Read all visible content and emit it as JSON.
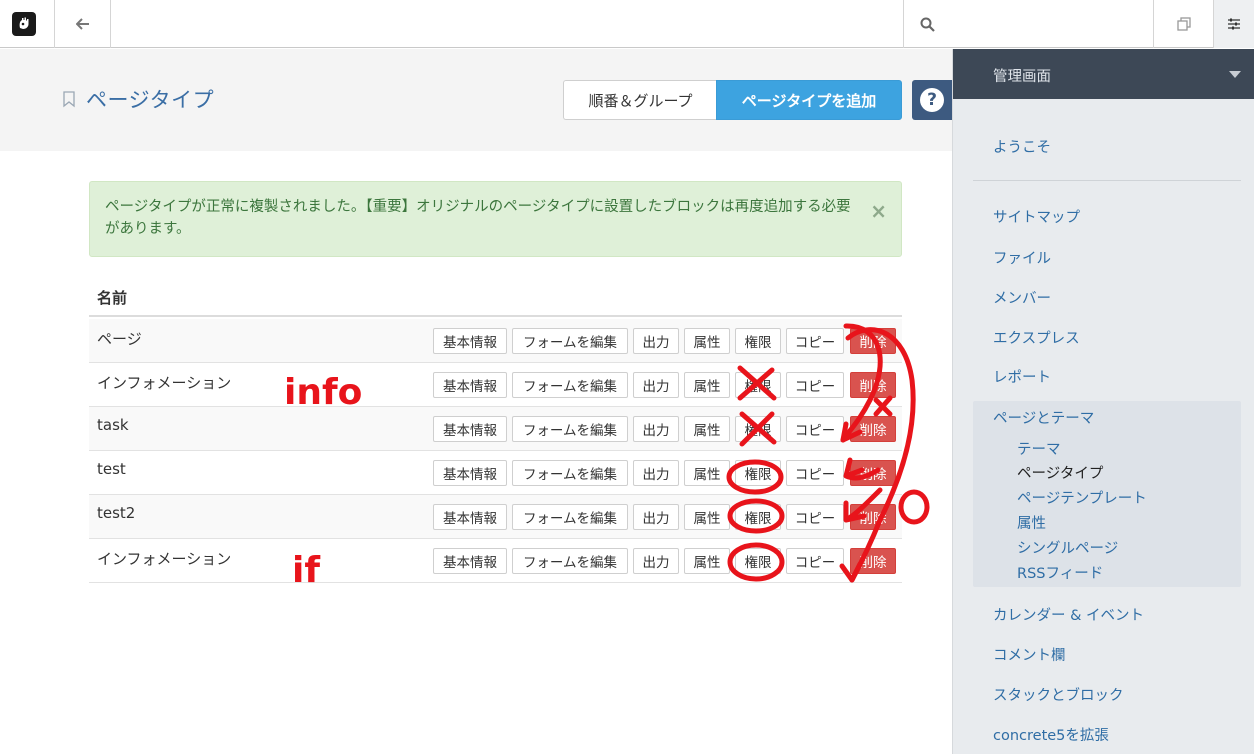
{
  "toolbar": {
    "logo_icon": "concrete5-logo-icon",
    "back_icon": "arrow-left-icon",
    "search_icon": "search-icon",
    "search_placeholder": "",
    "stack_icon": "stack-icon",
    "settings_icon": "sliders-icon"
  },
  "header": {
    "title": "ページタイプ",
    "order_button": "順番＆グループ",
    "add_button": "ページタイプを追加",
    "help_button": "?"
  },
  "alert": {
    "message": "ページタイプが正常に複製されました。【重要】オリジナルのページタイプに設置したブロックは再度追加する必要があります。",
    "close": "×"
  },
  "table": {
    "column_name": "名前",
    "actions": [
      "基本情報",
      "フォームを編集",
      "出力",
      "属性",
      "権限",
      "コピー",
      "削除"
    ],
    "rows": [
      {
        "name": "ページ"
      },
      {
        "name": "インフォメーション"
      },
      {
        "name": "task"
      },
      {
        "name": "test"
      },
      {
        "name": "test2"
      },
      {
        "name": "インフォメーション"
      }
    ]
  },
  "annotations": {
    "row2_note": "info",
    "row6_note": "if",
    "right_x": "x",
    "right_o": "o",
    "color": "#e8141b"
  },
  "sidebar": {
    "header": "管理画面",
    "welcome": "ようこそ",
    "items_top": [
      "サイトマップ",
      "ファイル",
      "メンバー",
      "エクスプレス",
      "レポート"
    ],
    "group_title": "ページとテーマ",
    "group_items": [
      "テーマ",
      "ページタイプ",
      "ページテンプレート",
      "属性",
      "シングルページ",
      "RSSフィード"
    ],
    "items_bottom": [
      "カレンダー & イベント",
      "コメント欄",
      "スタックとブロック",
      "concrete5を拡張"
    ]
  },
  "colors": {
    "accent": "#3da3e0",
    "danger": "#d9534f",
    "link": "#2f6da5",
    "sidebar_header": "#3d4856"
  }
}
